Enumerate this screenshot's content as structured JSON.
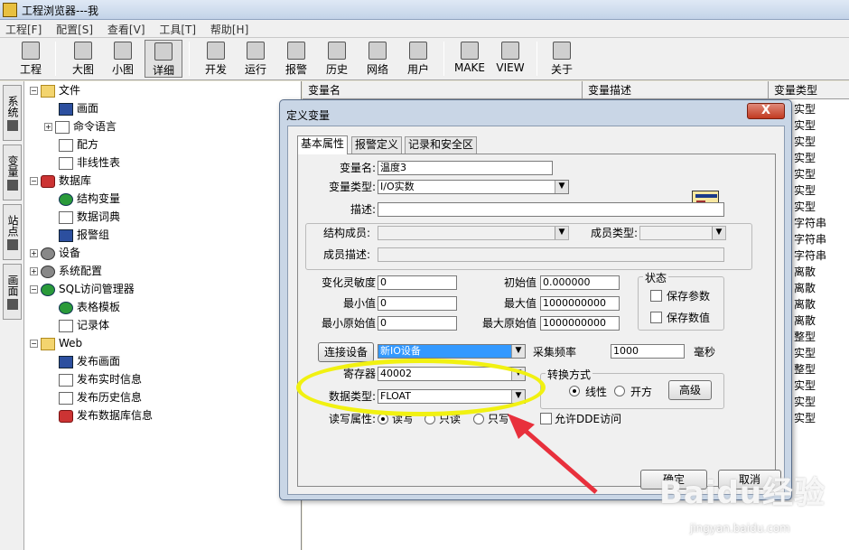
{
  "window": {
    "title": "工程浏览器---我"
  },
  "menu": [
    "工程[F]",
    "配置[S]",
    "查看[V]",
    "工具[T]",
    "帮助[H]"
  ],
  "toolbar": [
    "工程",
    "大图",
    "小图",
    "详细",
    "开发",
    "运行",
    "报警",
    "历史",
    "网络",
    "用户",
    "MAKE",
    "VIEW",
    "关于"
  ],
  "side_tabs": [
    "系统",
    "变量",
    "站点",
    "画面"
  ],
  "tree": [
    {
      "label": "文件",
      "level": 0,
      "expand": "-",
      "icon": "folder"
    },
    {
      "label": "画面",
      "level": 1,
      "icon": "screen"
    },
    {
      "label": "命令语言",
      "level": 1,
      "expand": "+",
      "icon": "page"
    },
    {
      "label": "配方",
      "level": 1,
      "icon": "page"
    },
    {
      "label": "非线性表",
      "level": 1,
      "icon": "page"
    },
    {
      "label": "数据库",
      "level": 0,
      "expand": "-",
      "icon": "db"
    },
    {
      "label": "结构变量",
      "level": 1,
      "icon": "struct"
    },
    {
      "label": "数据词典",
      "level": 1,
      "icon": "book"
    },
    {
      "label": "报警组",
      "level": 1,
      "icon": "alarm"
    },
    {
      "label": "设备",
      "level": 0,
      "expand": "+",
      "icon": "device"
    },
    {
      "label": "系统配置",
      "level": 0,
      "expand": "+",
      "icon": "tools"
    },
    {
      "label": "SQL访问管理器",
      "level": 0,
      "expand": "-",
      "icon": "sql"
    },
    {
      "label": "表格模板",
      "level": 1,
      "icon": "table"
    },
    {
      "label": "记录体",
      "level": 1,
      "icon": "page"
    },
    {
      "label": "Web",
      "level": 0,
      "expand": "-",
      "icon": "folder"
    },
    {
      "label": "发布画面",
      "level": 1,
      "icon": "screen"
    },
    {
      "label": "发布实时信息",
      "level": 1,
      "icon": "page"
    },
    {
      "label": "发布历史信息",
      "level": 1,
      "icon": "page"
    },
    {
      "label": "发布数据库信息",
      "level": 1,
      "icon": "db"
    }
  ],
  "list": {
    "headers": [
      "变量名",
      "变量描述",
      "变量类型"
    ],
    "types": [
      "实型",
      "实型",
      "实型",
      "实型",
      "实型",
      "实型",
      "实型",
      "字符串",
      "字符串",
      "字符串",
      "离散",
      "离散",
      "离散",
      "离散",
      "整型",
      "实型",
      "整型",
      "实型",
      "实型",
      "实型"
    ]
  },
  "dialog": {
    "title": "定义变量",
    "close": "X",
    "tabs": [
      "基本属性",
      "报警定义",
      "记录和安全区"
    ],
    "var_name_label": "变量名:",
    "var_name": "温度3",
    "var_type_label": "变量类型:",
    "var_type": "I/O实数",
    "desc_label": "描述:",
    "desc": "",
    "struct_member_label": "结构成员:",
    "member_type_label": "成员类型:",
    "member_desc_label": "成员描述:",
    "sensitivity_label": "变化灵敏度",
    "sensitivity": "0",
    "init_label": "初始值",
    "init": "0.000000",
    "min_label": "最小值",
    "min": "0",
    "max_label": "最大值",
    "max": "1000000000",
    "min_raw_label": "最小原始值",
    "min_raw": "0",
    "max_raw_label": "最大原始值",
    "max_raw": "1000000000",
    "state_title": "状态",
    "save_params": "保存参数",
    "save_value": "保存数值",
    "connect_btn": "连接设备",
    "device": "新IO设备",
    "freq_label": "采集频率",
    "freq": "1000",
    "freq_unit": "毫秒",
    "register_label": "寄存器",
    "register": "40002",
    "dtype_label": "数据类型:",
    "dtype": "FLOAT",
    "convert_title": "转换方式",
    "linear": "线性",
    "sqrt": "开方",
    "advanced": "高级",
    "rw_label": "读写属性:",
    "rw": "读写",
    "ro": "只读",
    "wo": "只写",
    "dde": "允许DDE访问",
    "ok": "确定",
    "cancel": "取消"
  },
  "watermark": {
    "brand": "Baidu经验",
    "url": "jingyan.baidu.com"
  },
  "annotation": {
    "ellipse_color": "#f1f111",
    "arrow_color": "#e8303c"
  }
}
